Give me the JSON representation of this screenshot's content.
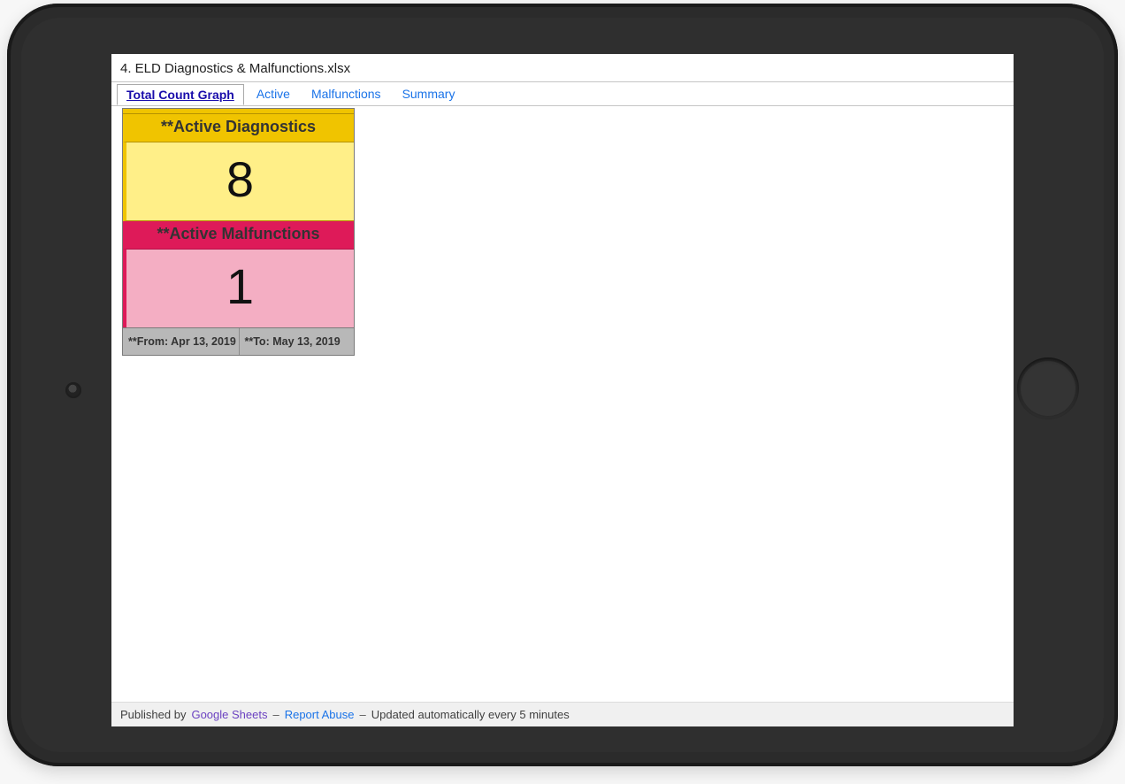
{
  "doc_title": "4. ELD Diagnostics & Malfunctions.xlsx",
  "tabs": [
    {
      "label": "Total Count Graph",
      "active": true
    },
    {
      "label": "Active",
      "active": false
    },
    {
      "label": "Malfunctions",
      "active": false
    },
    {
      "label": "Summary",
      "active": false
    }
  ],
  "card": {
    "diagnostics": {
      "header": "**Active Diagnostics",
      "value": "8"
    },
    "malfunctions": {
      "header": "**Active Malfunctions",
      "value": "1"
    },
    "from_label": "**From: Apr 13, 2019",
    "to_label": "**To: May 13, 2019"
  },
  "footer": {
    "published_by": "Published by",
    "google_sheets": "Google Sheets",
    "report_abuse": "Report Abuse",
    "auto_update": "Updated automatically every 5 minutes",
    "dash": "–"
  }
}
